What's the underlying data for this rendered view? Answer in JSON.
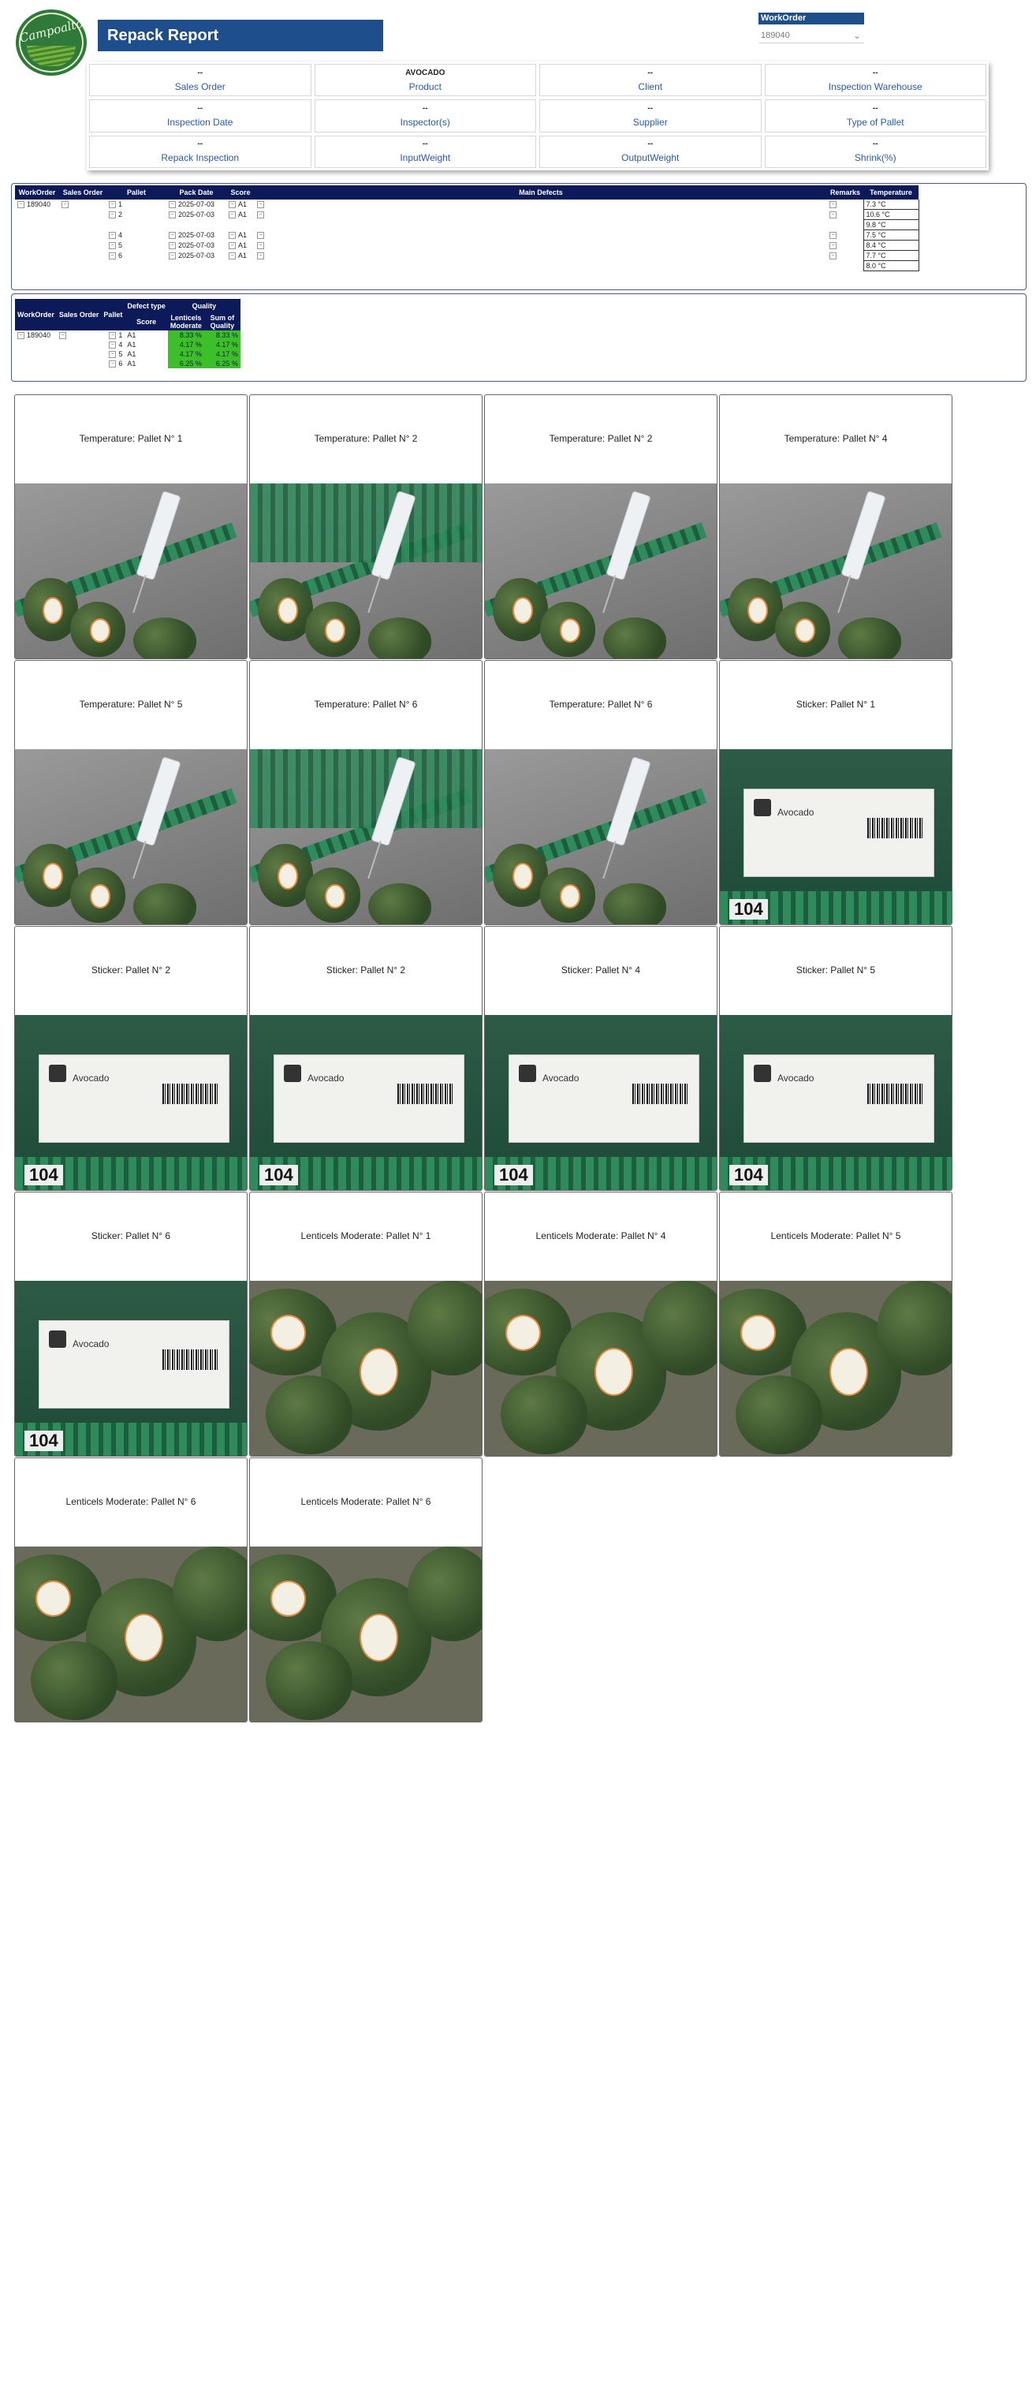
{
  "header": {
    "title": "Repack Report",
    "logo_text": "Campoalto"
  },
  "workorder_filter": {
    "label": "WorkOrder",
    "selected": "189040"
  },
  "info_cards": [
    {
      "value": "--",
      "label": "Sales Order"
    },
    {
      "value": "AVOCADO",
      "label": "Product"
    },
    {
      "value": "--",
      "label": "Client"
    },
    {
      "value": "--",
      "label": "Inspection Warehouse"
    },
    {
      "value": "--",
      "label": "Inspection Date"
    },
    {
      "value": "--",
      "label": "Inspector(s)"
    },
    {
      "value": "--",
      "label": "Supplier"
    },
    {
      "value": "--",
      "label": "Type of Pallet"
    },
    {
      "value": "--",
      "label": "Repack Inspection"
    },
    {
      "value": "--",
      "label": "InputWeight"
    },
    {
      "value": "--",
      "label": "OutputWeight"
    },
    {
      "value": "--",
      "label": "Shrink(%)"
    }
  ],
  "pallet_table": {
    "headers": [
      "WorkOrder",
      "Sales Order",
      "Pallet",
      "Pack Date",
      "Score",
      "Main Defects",
      "Remarks",
      "Temperature"
    ],
    "workorder": "189040",
    "rows": [
      {
        "pallet": "1",
        "pack_date": "2025-07-03",
        "score": "A1",
        "temps": [
          "7.3 °C"
        ]
      },
      {
        "pallet": "2",
        "pack_date": "2025-07-03",
        "score": "A1",
        "temps": [
          "10.6 °C",
          "9.8 °C"
        ]
      },
      {
        "pallet": "4",
        "pack_date": "2025-07-03",
        "score": "A1",
        "temps": [
          "7.5 °C"
        ]
      },
      {
        "pallet": "5",
        "pack_date": "2025-07-03",
        "score": "A1",
        "temps": [
          "8.4 °C"
        ]
      },
      {
        "pallet": "6",
        "pack_date": "2025-07-03",
        "score": "A1",
        "temps": [
          "7.7 °C",
          "8.0 °C"
        ]
      }
    ]
  },
  "quality_table": {
    "headers": [
      "WorkOrder",
      "Sales Order",
      "Pallet",
      "Score",
      "Lenticels Moderate",
      "Sum of Quality"
    ],
    "group_headers": [
      "Defect type",
      "Quality"
    ],
    "workorder": "189040",
    "rows": [
      {
        "pallet": "1",
        "score": "A1",
        "lenticels": "8.33 %",
        "sum": "8.33 %"
      },
      {
        "pallet": "4",
        "score": "A1",
        "lenticels": "4.17 %",
        "sum": "4.17 %"
      },
      {
        "pallet": "5",
        "score": "A1",
        "lenticels": "4.17 %",
        "sum": "4.17 %"
      },
      {
        "pallet": "6",
        "score": "A1",
        "lenticels": "6.25 %",
        "sum": "6.25 %"
      }
    ]
  },
  "photos": [
    {
      "caption": "Temperature: Pallet N° 1",
      "kind": "thermo"
    },
    {
      "caption": "Temperature: Pallet N° 2",
      "kind": "thermo-crate"
    },
    {
      "caption": "Temperature: Pallet N° 2",
      "kind": "thermo-floor"
    },
    {
      "caption": "Temperature: Pallet N° 4",
      "kind": "thermo"
    },
    {
      "caption": "Temperature: Pallet N° 5",
      "kind": "thermo-floor"
    },
    {
      "caption": "Temperature: Pallet N° 6",
      "kind": "thermo-crate"
    },
    {
      "caption": "Temperature: Pallet N° 6",
      "kind": "thermo"
    },
    {
      "caption": "Sticker: Pallet N° 1",
      "kind": "sticker"
    },
    {
      "caption": "Sticker: Pallet N° 2",
      "kind": "sticker"
    },
    {
      "caption": "Sticker: Pallet N° 2",
      "kind": "sticker"
    },
    {
      "caption": "Sticker: Pallet N° 4",
      "kind": "sticker"
    },
    {
      "caption": "Sticker: Pallet N° 5",
      "kind": "sticker"
    },
    {
      "caption": "Sticker: Pallet N° 6",
      "kind": "sticker"
    },
    {
      "caption": "Lenticels Moderate: Pallet N° 1",
      "kind": "fruit"
    },
    {
      "caption": "Lenticels Moderate: Pallet N° 4",
      "kind": "fruit"
    },
    {
      "caption": "Lenticels Moderate: Pallet N° 5",
      "kind": "fruit"
    },
    {
      "caption": "Lenticels Moderate: Pallet N° 6",
      "kind": "fruit"
    },
    {
      "caption": "Lenticels Moderate: Pallet N° 6",
      "kind": "fruit"
    }
  ],
  "sticker_text": {
    "brand": "Avocado",
    "crate_number": "104"
  },
  "colors": {
    "title_bar": "#1f4e8c",
    "table_header": "#0c1a5a",
    "quality_fill": "#3cbf28",
    "label_text": "#2a5aa8"
  }
}
